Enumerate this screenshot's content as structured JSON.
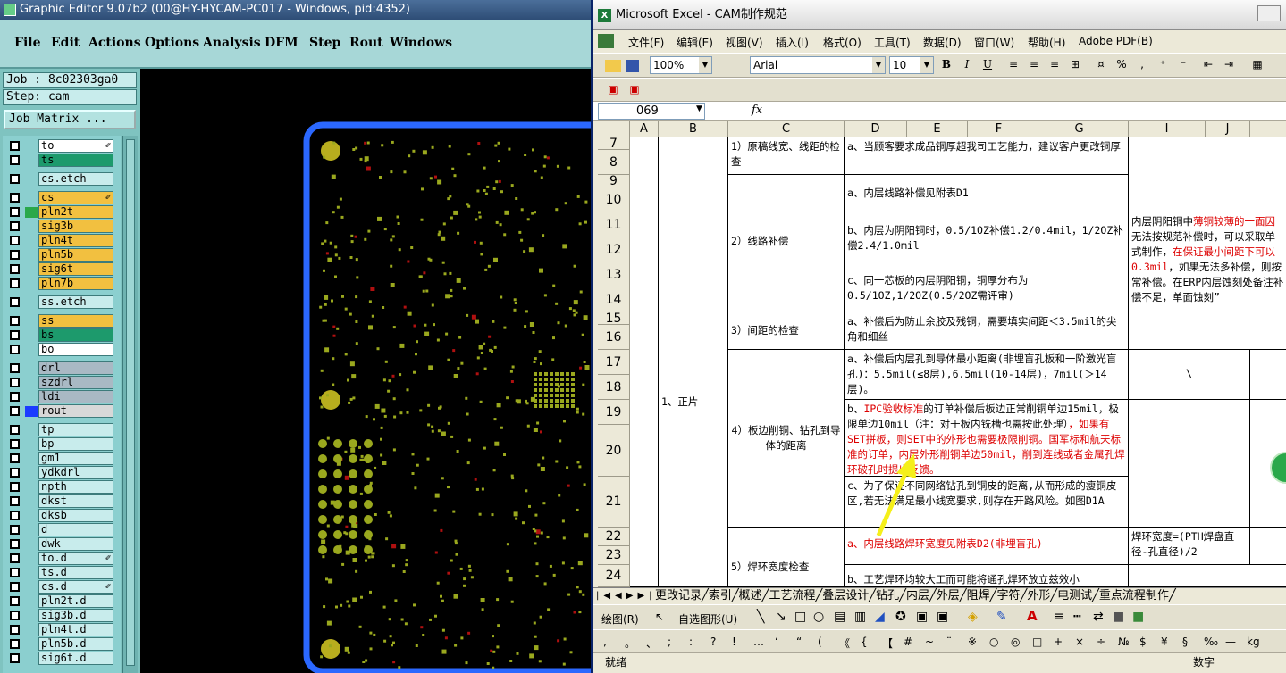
{
  "graphic_editor": {
    "title": "Graphic Editor 9.07b2 (00@HY-HYCAM-PC017 - Windows, pid:4352)",
    "menu": [
      "File",
      "Edit",
      "Actions",
      "Options",
      "Analysis",
      "DFM",
      "Step",
      "Rout",
      "Windows"
    ],
    "job_label": "Job : 8c02303ga0",
    "step_label": "Step: cam",
    "job_matrix_label": "Job Matrix ...",
    "layers": [
      {
        "name": "to",
        "color": "#ffffff",
        "flag": "✐"
      },
      {
        "name": "ts",
        "color": "#1d9a6c",
        "flag": ""
      },
      {
        "name": "cs.etch",
        "color": "#c8ecec",
        "flag": ""
      },
      {
        "name": "cs",
        "color": "#f2c040",
        "flag": "✐"
      },
      {
        "name": "pln2t",
        "color": "#f2c040",
        "flag": ""
      },
      {
        "name": "sig3b",
        "color": "#f2c040",
        "flag": ""
      },
      {
        "name": "pln4t",
        "color": "#f2c040",
        "flag": ""
      },
      {
        "name": "pln5b",
        "color": "#f2c040",
        "flag": ""
      },
      {
        "name": "sig6t",
        "color": "#f2c040",
        "flag": ""
      },
      {
        "name": "pln7b",
        "color": "#f2c040",
        "flag": ""
      },
      {
        "name": "ss.etch",
        "color": "#c8ecec",
        "flag": ""
      },
      {
        "name": "ss",
        "color": "#f2c040",
        "flag": ""
      },
      {
        "name": "bs",
        "color": "#1d9a6c",
        "flag": ""
      },
      {
        "name": "bo",
        "color": "#ffffff",
        "flag": ""
      },
      {
        "name": "drl",
        "color": "#a9b9c4",
        "flag": ""
      },
      {
        "name": "szdrl",
        "color": "#a9b9c4",
        "flag": ""
      },
      {
        "name": "ldi",
        "color": "#a9b9c4",
        "flag": ""
      },
      {
        "name": "rout",
        "color": "#d8d8d8",
        "flag": ""
      },
      {
        "name": "tp",
        "color": "#c8ecec",
        "flag": ""
      },
      {
        "name": "bp",
        "color": "#c8ecec",
        "flag": ""
      },
      {
        "name": "gm1",
        "color": "#c8ecec",
        "flag": ""
      },
      {
        "name": "ydkdrl",
        "color": "#c8ecec",
        "flag": ""
      },
      {
        "name": "npth",
        "color": "#c8ecec",
        "flag": ""
      },
      {
        "name": "dkst",
        "color": "#c8ecec",
        "flag": ""
      },
      {
        "name": "dksb",
        "color": "#c8ecec",
        "flag": ""
      },
      {
        "name": "d",
        "color": "#c8ecec",
        "flag": ""
      },
      {
        "name": "dwk",
        "color": "#c8ecec",
        "flag": ""
      },
      {
        "name": "to.d",
        "color": "#c8ecec",
        "flag": "✐"
      },
      {
        "name": "ts.d",
        "color": "#c8ecec",
        "flag": ""
      },
      {
        "name": "cs.d",
        "color": "#c8ecec",
        "flag": "✐"
      },
      {
        "name": "pln2t.d",
        "color": "#c8ecec",
        "flag": ""
      },
      {
        "name": "sig3b.d",
        "color": "#c8ecec",
        "flag": ""
      },
      {
        "name": "pln4t.d",
        "color": "#c8ecec",
        "flag": ""
      },
      {
        "name": "pln5b.d",
        "color": "#c8ecec",
        "flag": ""
      },
      {
        "name": "sig6t.d",
        "color": "#c8ecec",
        "flag": ""
      }
    ]
  },
  "excel": {
    "title": "Microsoft Excel - CAM制作规范",
    "menu": [
      "文件(F)",
      "编辑(E)",
      "视图(V)",
      "插入(I)",
      "格式(O)",
      "工具(T)",
      "数据(D)",
      "窗口(W)",
      "帮助(H)",
      "Adobe PDF(B)"
    ],
    "zoom": "100%",
    "font_name": "Arial",
    "font_size": "10",
    "name_box": "069",
    "fx_label": "fx",
    "columns": [
      "A",
      "B",
      "C",
      "D",
      "E",
      "F",
      "G",
      "I",
      "J"
    ],
    "rows": [
      "7",
      "8",
      "9",
      "10",
      "11",
      "12",
      "13",
      "14",
      "15",
      "16",
      "17",
      "18",
      "19",
      "20",
      "21",
      "22",
      "23",
      "24"
    ],
    "cells": {
      "b_main": "1、正片",
      "c1": "1）原稿线宽、线距的检查",
      "c2": "2）线路补偿",
      "c3": "3）间距的检查",
      "c4": "4）板边削铜、钻孔到导体的距离",
      "c5": "5）焊环宽度检查",
      "d7": "a、当顾客要求成品铜厚超我司工艺能力，建议客户更改铜厚",
      "d9": "a、内层线路补偿见附表D1",
      "d11": "b、内层为阴阳铜时，0.5/1OZ补偿1.2/0.4mil，1/2OZ补偿2.4/1.0mil",
      "d13": "c、同一芯板的内层阴阳铜，铜厚分布为0.5/1OZ,1/2OZ(0.5/2OZ需评审)",
      "d15": "a、补偿后为防止余胶及残铜，需要填实间距＜3.5mil的尖角和细丝",
      "d17": "a、补偿后内层孔到导体最小距离(非埋盲孔板和一阶激光盲孔)：5.5mil(≤8层),6.5mil(10-14层)，7mil(＞14层)。",
      "d19_a": "b、",
      "d19_b": "IPC验收标准",
      "d19_c": "的订单补偿后板边正常削铜单边15mil，极限单边10mil（注：对于板内铣槽也需按此处理）",
      "d19_d": "，如果有SET拼板，则SET中的外形也需要极限削铜。国军标和航天标准的订单，内层外形削铜单边50mil，削到连线或者金属孔焊环破孔时提出反馈。",
      "d21": "c、为了保证不同网络钻孔到铜皮的距离,从而形成的瘦铜皮区,若无法满足最小线宽要求,则存在开路风险。如图D1A",
      "d22": "a、内层线路焊环宽度见附表D2(非埋盲孔)",
      "d24": "b、工艺焊环均较大工而可能将通孔焊环放立兹效小",
      "i11_a": "内层阴阳铜中",
      "i11_b": "薄铜较薄的一面因",
      "i11_c": "无法按规范补偿时，可以采取单",
      "i11_d": "式制作，",
      "i11_e": "在保证最小间距下可以",
      "i11_f": "0.3mil",
      "i11_g": "，如果无法多补偿，则按",
      "i11_h": "常补偿。在ERP内层蚀刻处备注",
      "i11_i": "补偿不足，单面蚀刻”",
      "i17": "\\",
      "i22": "焊环宽度=(PTH焊盘直径-孔直径)/2"
    },
    "sheet_tabs": "更改记录╱索引╱概述╱工艺流程╱叠层设计╱钻孔╱内层╱外层╱阻焊╱字符╱外形╱电测试╱重点流程制作╱",
    "draw_label": "绘图(R)",
    "autoshape_label": "自选图形(U)",
    "symbols": [
      ",",
      "。",
      "、",
      ";",
      ":",
      "?",
      "!",
      "…",
      "‘",
      "“",
      "(",
      "《",
      "{",
      "【",
      "#",
      "~",
      "¨",
      "※",
      "○",
      "◎",
      "□",
      "+",
      "×",
      "÷",
      "№",
      "$",
      "¥",
      "§",
      "‰",
      "—",
      "kg"
    ],
    "status_left": "就绪",
    "status_right": "数字"
  }
}
